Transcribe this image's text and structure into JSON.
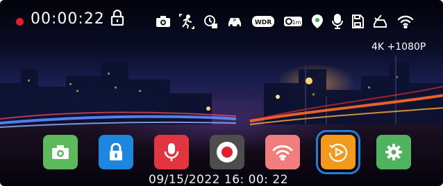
{
  "status_bar": {
    "recording_indicator_color": "#e0212b",
    "timer": "00:00:22",
    "icons": [
      "lock-icon",
      "camera-icon",
      "motion-detect-icon",
      "timelapse-icon",
      "parking-mode-icon",
      "wdr-icon",
      "loop-recording-icon",
      "gps-icon",
      "microphone-icon",
      "storage-icon",
      "vehicle-check-icon",
      "wifi-icon"
    ],
    "wdr_label": "WDR",
    "loop_label": "1m"
  },
  "resolution": "4K +1080P",
  "apps": [
    {
      "name": "camera-icon",
      "color": "#5cba5a"
    },
    {
      "name": "lock-icon",
      "color": "#1f86e0"
    },
    {
      "name": "microphone-icon",
      "color": "#e2353f"
    },
    {
      "name": "record-icon",
      "color": "#4d4d4d"
    },
    {
      "name": "wifi-icon",
      "color": "#f27d7d"
    },
    {
      "name": "playback-icon",
      "color": "#f39a1e",
      "selected": true
    },
    {
      "name": "settings-icon",
      "color": "#4fb35f"
    }
  ],
  "datetime": "09/15/2022 16: 00: 22"
}
